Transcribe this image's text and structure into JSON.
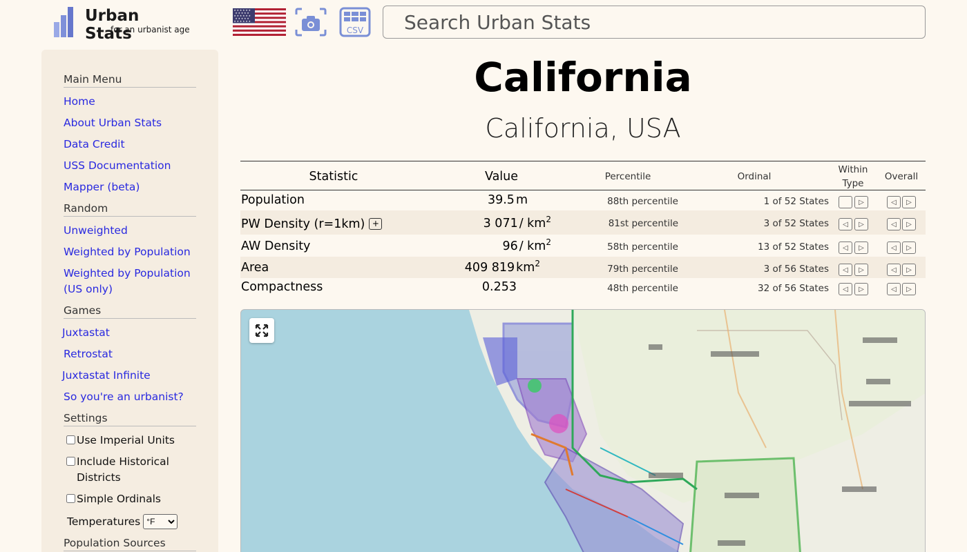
{
  "header": {
    "logo_title": "Urban Stats",
    "logo_subtitle": "for an urbanist age",
    "search_placeholder": "Search Urban Stats",
    "csv_label": "CSV"
  },
  "sidebar": {
    "main_menu_title": "Main Menu",
    "main_menu": [
      "Home",
      "About Urban Stats",
      "Data Credit",
      "USS Documentation",
      "Mapper (beta)"
    ],
    "random_title": "Random",
    "random": [
      "Unweighted",
      "Weighted by Population",
      "Weighted by Population (US only)"
    ],
    "games_title": "Games",
    "games": [
      "Juxtastat",
      "Retrostat",
      "Juxtastat Infinite",
      "So you're an urbanist?"
    ],
    "settings_title": "Settings",
    "settings": [
      {
        "label": "Use Imperial Units",
        "checked": false
      },
      {
        "label": "Include Historical Districts",
        "checked": false
      },
      {
        "label": "Simple Ordinals",
        "checked": false
      }
    ],
    "temperature_label": "Temperatures",
    "temperature_value": "°F",
    "population_sources_title": "Population Sources"
  },
  "page": {
    "title": "California",
    "subtitle": "California, USA"
  },
  "table": {
    "headers": {
      "statistic": "Statistic",
      "value": "Value",
      "percentile": "Percentile",
      "ordinal": "Ordinal",
      "within_type_line1": "Within",
      "within_type_line2": "Type",
      "overall": "Overall"
    },
    "rows": [
      {
        "name": "Population",
        "value": "39.5",
        "unit": "m",
        "sup": "",
        "percentile": "88th percentile",
        "ordinal": "1 of 52 States"
      },
      {
        "name": "PW Density (r=1km)",
        "value": "3 071",
        "unit": "/ km",
        "sup": "2",
        "percentile": "81st percentile",
        "ordinal": "3 of 52 States"
      },
      {
        "name": "AW Density",
        "value": "96",
        "unit": "/ km",
        "sup": "2",
        "percentile": "58th percentile",
        "ordinal": "13 of 52 States"
      },
      {
        "name": "Area",
        "value": "409 819",
        "unit": "km",
        "sup": "2",
        "percentile": "79th percentile",
        "ordinal": "3 of 56 States"
      },
      {
        "name": "Compactness",
        "value": "0.253",
        "unit": "",
        "sup": "",
        "percentile": "48th percentile",
        "ordinal": "32 of 56 States"
      }
    ],
    "expand_symbol": "+",
    "prev_symbol": "◁",
    "next_symbol": "▷"
  },
  "colors": {
    "link": "#2929e0",
    "background": "#fdf8f0",
    "sidebar": "#f5ede1",
    "logo_accent": "#7a8fd6"
  }
}
